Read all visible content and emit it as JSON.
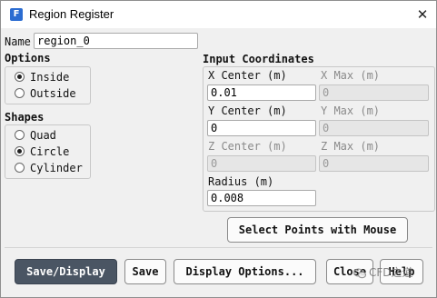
{
  "window": {
    "title": "Region Register",
    "app_icon_letter": "F",
    "close_glyph": "✕"
  },
  "name": {
    "label": "Name",
    "value": "region_0"
  },
  "options": {
    "title": "Options",
    "items": [
      {
        "label": "Inside",
        "checked": true
      },
      {
        "label": "Outside",
        "checked": false
      }
    ]
  },
  "shapes": {
    "title": "Shapes",
    "items": [
      {
        "label": "Quad",
        "checked": false
      },
      {
        "label": "Circle",
        "checked": true
      },
      {
        "label": "Cylinder",
        "checked": false
      }
    ]
  },
  "coords": {
    "title": "Input Coordinates",
    "x_center": {
      "label": "X Center (m)",
      "value": "0.01"
    },
    "x_max": {
      "label": "X Max (m)",
      "value": "0"
    },
    "y_center": {
      "label": "Y Center (m)",
      "value": "0"
    },
    "y_max": {
      "label": "Y Max (m)",
      "value": "0"
    },
    "z_center": {
      "label": "Z Center (m)",
      "value": "0"
    },
    "z_max": {
      "label": "Z Max (m)",
      "value": "0"
    },
    "radius": {
      "label": "Radius (m)",
      "value": "0.008"
    }
  },
  "select_points_button": "Select Points with Mouse",
  "buttons": {
    "save_display": "Save/Display",
    "save": "Save",
    "display_options": "Display Options...",
    "close": "Close",
    "help": "Help"
  },
  "watermark": {
    "text": "CFD之道",
    "icon": "wechat-icon"
  },
  "colors": {
    "primary_button": "#4a5563",
    "app_icon": "#2b6cd1"
  }
}
